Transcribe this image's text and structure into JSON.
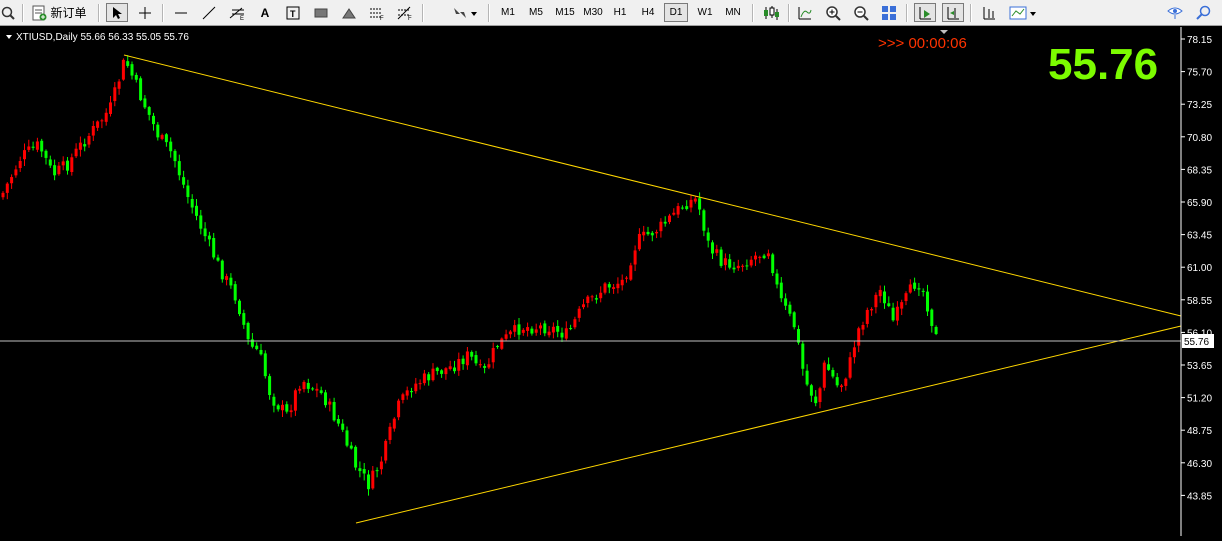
{
  "toolbar": {
    "new_order_label": "新订单",
    "timeframes": [
      "M1",
      "M5",
      "M15",
      "M30",
      "H1",
      "H4",
      "D1",
      "W1",
      "MN"
    ],
    "active_timeframe": "D1",
    "icons": [
      "zoom-fit-icon",
      "new-order-icon",
      "cursor-icon",
      "crosshair-icon",
      "hline-icon",
      "trendline-icon",
      "fib-expansion-icon",
      "text-icon",
      "label-icon",
      "rectangle-icon",
      "triangle-icon",
      "fib-fan-icon",
      "fib-arc-icon",
      "arrows-menu-icon",
      "indicators-icon",
      "bar-chart-icon",
      "candlestick-icon",
      "zoom-in-icon",
      "zoom-out-icon",
      "tile-windows-icon",
      "autoscroll-icon",
      "chart-shift-icon",
      "period-sep-icon",
      "templates-icon",
      "help-icon",
      "search-icon"
    ]
  },
  "chart": {
    "header": "XTIUSD,Daily  55.66 56.33 55.05 55.76",
    "countdown": ">>> 00:00:06",
    "big_price": "55.76",
    "current_price_label": "55.76",
    "y_ticks": [
      "78.15",
      "75.70",
      "73.25",
      "70.80",
      "68.35",
      "65.90",
      "63.45",
      "61.00",
      "58.55",
      "56.10",
      "53.65",
      "51.20",
      "48.75",
      "46.30",
      "43.85"
    ],
    "colors": {
      "background": "#000000",
      "bull": "#ff0000",
      "bear": "#00ff00",
      "trendline": "#ffd700",
      "big_price": "#7cfc00",
      "countdown": "#ff3300",
      "axis_text": "#ffffff"
    }
  }
}
